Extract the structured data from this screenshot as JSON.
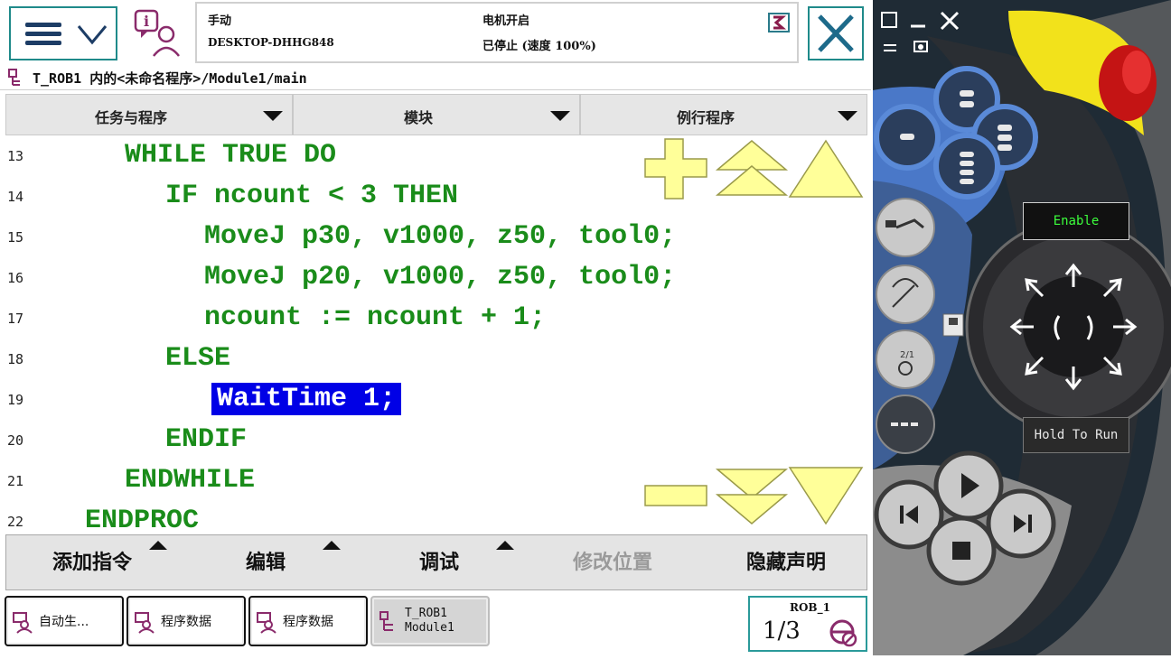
{
  "header": {
    "mode": "手动",
    "controller": "DESKTOP-DHHG848",
    "motor_state": "电机开启",
    "program_state": "已停止 (速度 100%)"
  },
  "path": "T_ROB1 内的<未命名程序>/Module1/main",
  "filters": [
    {
      "label": "任务与程序"
    },
    {
      "label": "模块"
    },
    {
      "label": "例行程序"
    }
  ],
  "code_lines": [
    {
      "num": "13",
      "text": "WHILE TRUE DO"
    },
    {
      "num": "14",
      "text": "IF ncount < 3 THEN"
    },
    {
      "num": "15",
      "text": "MoveJ p30, v1000, z50, tool0;"
    },
    {
      "num": "16",
      "text": "MoveJ p20, v1000, z50, tool0;"
    },
    {
      "num": "17",
      "text": "ncount := ncount + 1;"
    },
    {
      "num": "18",
      "text": "ELSE"
    },
    {
      "num": "19",
      "text": "WaitTime 1;"
    },
    {
      "num": "20",
      "text": "ENDIF"
    },
    {
      "num": "21",
      "text": "ENDWHILE"
    },
    {
      "num": "22",
      "text": "ENDPROC"
    }
  ],
  "toolbar": {
    "add_instruction": "添加指令",
    "edit": "编辑",
    "debug": "调试",
    "modify_position": "修改位置",
    "hide_declarations": "隐藏声明"
  },
  "taskbar": [
    {
      "label": "自动生..."
    },
    {
      "label": "程序数据"
    },
    {
      "label": "程序数据"
    },
    {
      "line1": "T_ROB1",
      "line2": "Module1"
    }
  ],
  "robot_status": {
    "name": "ROB_1",
    "fraction": "1/3"
  },
  "pendant": {
    "enable": "Enable",
    "hold_to_run": "Hold To Run"
  },
  "colors": {
    "code_green": "#1a8c1a",
    "selection_blue": "#0000e6",
    "accent_teal": "#1f8a8a",
    "zoom_yellow": "#ffff99"
  }
}
